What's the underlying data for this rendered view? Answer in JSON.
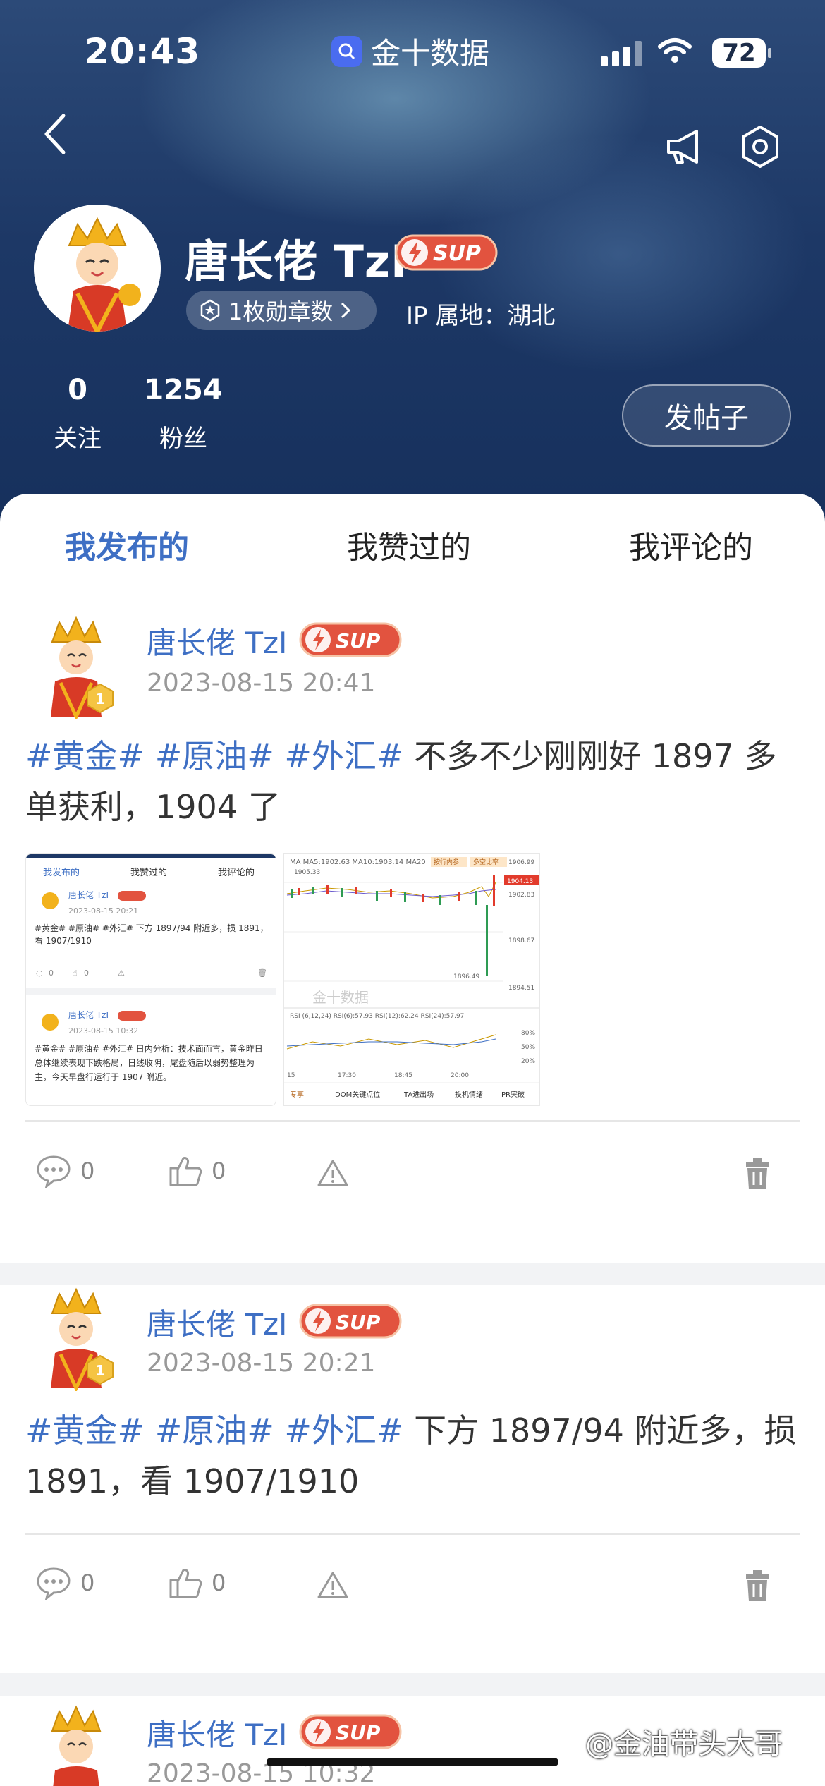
{
  "status": {
    "time": "20:43",
    "app_name": "金十数据",
    "battery": "72"
  },
  "profile": {
    "name": "唐长佬 TzI",
    "badge": "SUP",
    "medals": "1枚勋章数",
    "ip_location": "IP 属地：湖北",
    "following_count": "0",
    "following_label": "关注",
    "fans_count": "1254",
    "fans_label": "粉丝",
    "post_button": "发帖子"
  },
  "tabs": [
    {
      "label": "我发布的",
      "active": true
    },
    {
      "label": "我赞过的",
      "active": false
    },
    {
      "label": "我评论的",
      "active": false
    }
  ],
  "posts": [
    {
      "author": "唐长佬 TzI",
      "time": "2023-08-15 20:41",
      "tags": "#黄金# #原油# #外汇#",
      "text": " 不多不少刚刚好 1897 多单获利，1904 了",
      "comments": "0",
      "likes": "0"
    },
    {
      "author": "唐长佬 TzI",
      "time": "2023-08-15 20:21",
      "tags": "#黄金# #原油# #外汇#",
      "text": " 下方 1897/94 附近多，损 1891，看 1907/1910",
      "comments": "0",
      "likes": "0"
    },
    {
      "author": "唐长佬 TzI",
      "time": "2023-08-15 10:32"
    }
  ],
  "thumb1": {
    "tabs": [
      "我发布的",
      "我赞过的",
      "我评论的"
    ],
    "p1_name": "唐长佬 TzI",
    "p1_time": "2023-08-15 20:21",
    "p1_text": "#黄金# #原油# #外汇# 下方 1897/94 附近多，损 1891，看 1907/1910",
    "p1_c": "0",
    "p1_l": "0",
    "p2_name": "唐长佬 TzI",
    "p2_time": "2023-08-15 10:32",
    "p2_text": "#黄金# #原油# #外汇# 日内分析：技术面而言，黄金昨日总体继续表现下跌格局，日线收阴，尾盘随后以弱势整理为主，今天早盘行运行于 1907 附近。"
  },
  "thumb2": {
    "ma_line": "MA MA5:1902.63  MA10:1903.14  MA20",
    "btn1": "按行内参",
    "btn2": "多空比率",
    "prices": [
      "1906.99",
      "1904.13",
      "1902.83",
      "1898.67",
      "1894.51"
    ],
    "high_label": "1905.33",
    "low_label": "1896.49",
    "wm": "金十数据",
    "rsi_line": "RSI  (6,12,24)  RSI(6):57.93  RSI(12):62.24  RSI(24):57.97",
    "rsi_levels": [
      "80%",
      "50%",
      "20%"
    ],
    "times": [
      "15",
      "17:30",
      "18:45",
      "20:00"
    ],
    "bottom": [
      "专享",
      "DOM关键点位",
      "TA进出场",
      "投机情绪",
      "PR突破"
    ]
  },
  "watermark": "@金油带头大哥",
  "colors": {
    "accent": "#3e6fc4",
    "header_dark": "#1d3866",
    "badge_red": "#e84f3d"
  }
}
